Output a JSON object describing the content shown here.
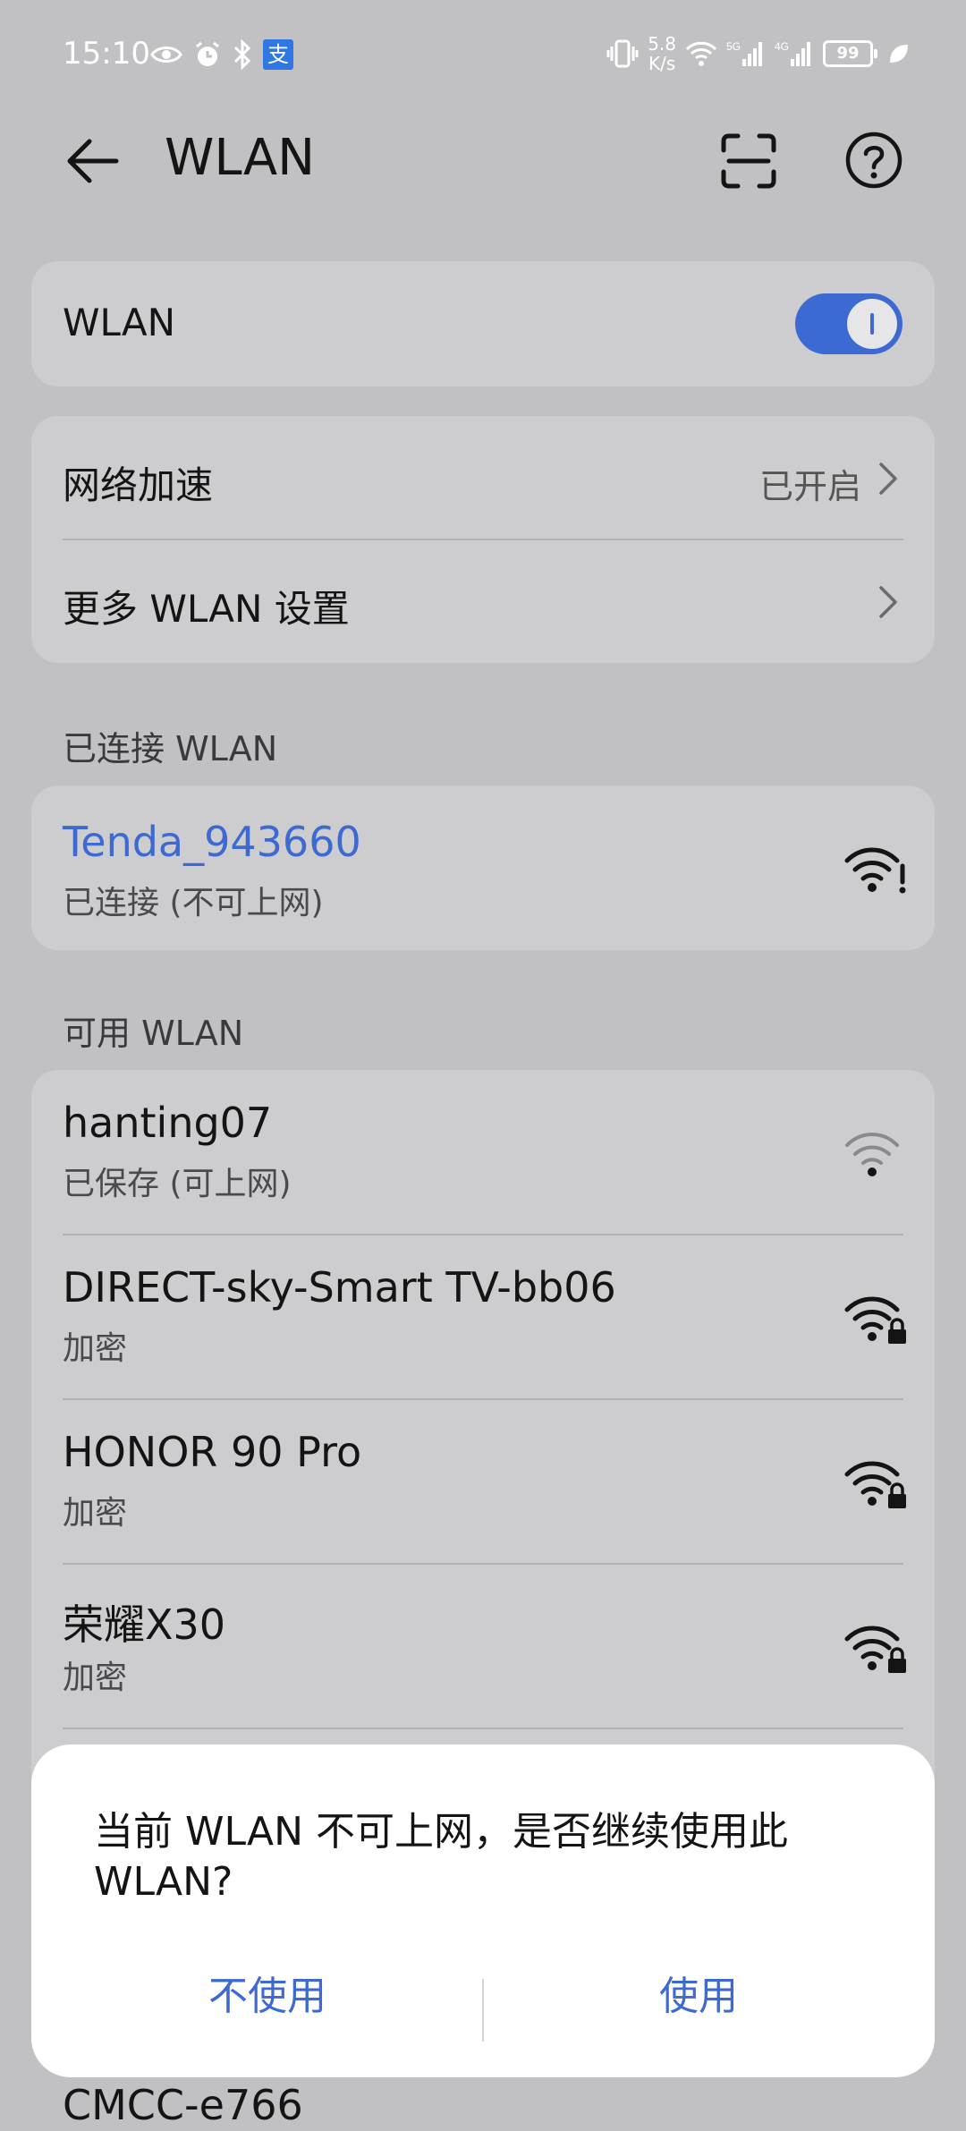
{
  "status_bar": {
    "time": "15:10",
    "net_speed_value": "5.8",
    "net_speed_unit": "K/s",
    "battery": "99",
    "left_icons": [
      "eye-icon",
      "alarm-icon",
      "bluetooth-icon",
      "alipay-icon"
    ],
    "alipay_glyph": "支",
    "right_icons": [
      "vibrate-icon",
      "wifi-icon",
      "signal-5g-icon",
      "signal-4g-icon",
      "battery-icon",
      "leaf-icon"
    ]
  },
  "header": {
    "title": "WLAN",
    "icons": [
      "back-arrow-icon",
      "scan-icon",
      "help-icon"
    ]
  },
  "wlan_toggle": {
    "label": "WLAN",
    "state": "on"
  },
  "settings": {
    "network_accel": {
      "label": "网络加速",
      "value": "已开启"
    },
    "more_settings": {
      "label": "更多 WLAN 设置"
    }
  },
  "connected": {
    "section_title": "已连接 WLAN",
    "network": {
      "name": "Tenda_943660",
      "status": "已连接 (不可上网)",
      "icon": "wifi-warning-icon"
    }
  },
  "available": {
    "section_title": "可用 WLAN",
    "networks": [
      {
        "name": "hanting07",
        "status": "已保存 (可上网)",
        "icon": "wifi-icon"
      },
      {
        "name": "DIRECT-sky-Smart TV-bb06",
        "status": "加密",
        "icon": "wifi-lock-icon"
      },
      {
        "name": "HONOR 90 Pro",
        "status": "加密",
        "icon": "wifi-lock-icon"
      },
      {
        "name": "荣耀X30",
        "status": "加密",
        "icon": "wifi-lock-icon"
      }
    ],
    "partial_network": {
      "name": "CMCC-e766"
    }
  },
  "dialog": {
    "message": "当前 WLAN 不可上网，是否继续使用此 WLAN?",
    "cancel_label": "不使用",
    "confirm_label": "使用"
  },
  "colors": {
    "accent": "#3c6ad2",
    "background": "#c1c1c3",
    "card": "#cdcdcf"
  }
}
